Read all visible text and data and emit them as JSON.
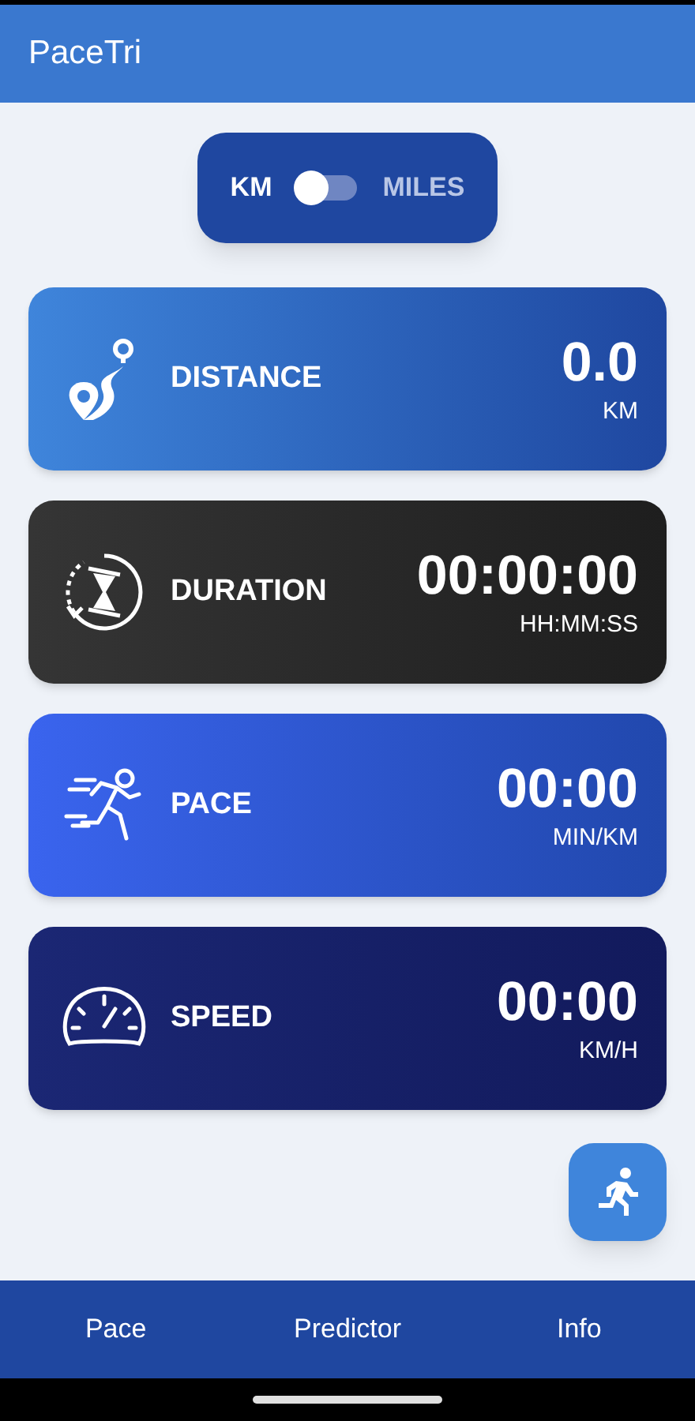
{
  "app_bar": {
    "title": "PaceTri"
  },
  "unit_toggle": {
    "left_label": "KM",
    "right_label": "MILES",
    "on": false
  },
  "cards": [
    {
      "kind": "distance",
      "label": "DISTANCE",
      "value": "0.0",
      "unit": "KM"
    },
    {
      "kind": "duration",
      "label": "DURATION",
      "value": "00:00:00",
      "unit": "HH:MM:SS"
    },
    {
      "kind": "pace",
      "label": "PACE",
      "value": "00:00",
      "unit": "MIN/KM"
    },
    {
      "kind": "speed",
      "label": "SPEED",
      "value": "00:00",
      "unit": "KM/H"
    }
  ],
  "bottom_nav": [
    {
      "label": "Pace"
    },
    {
      "label": "Predictor"
    },
    {
      "label": "Info"
    }
  ]
}
